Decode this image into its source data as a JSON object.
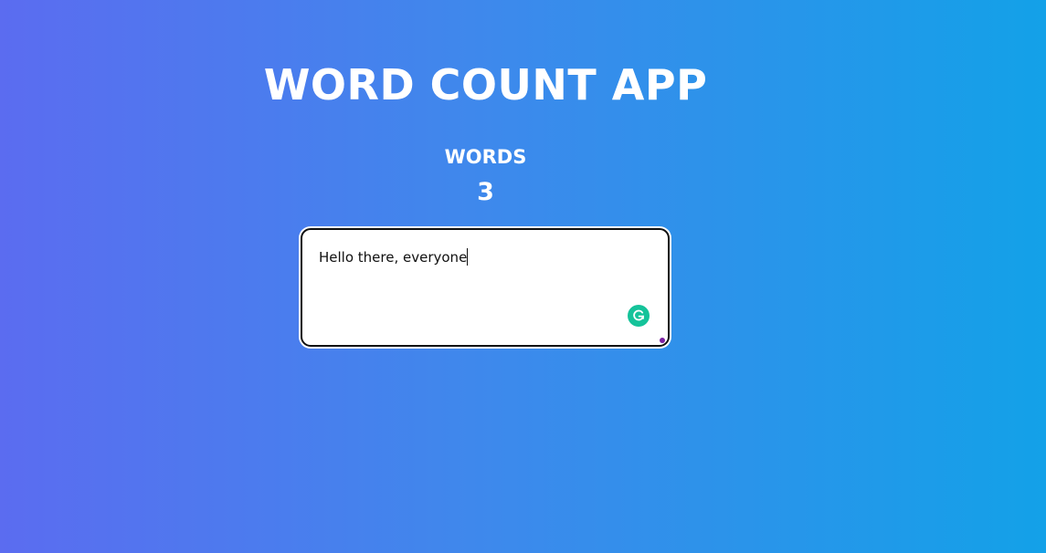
{
  "app": {
    "title": "WORD COUNT APP"
  },
  "counter": {
    "label": "WORDS",
    "value": "3"
  },
  "editor": {
    "text": "Hello there, everyone"
  },
  "icons": {
    "grammarly": "grammarly-icon",
    "resize": "resize-handle-icon"
  },
  "colors": {
    "gradient_start": "#5b6cf0",
    "gradient_end": "#13a1e8",
    "grammarly_green": "#15c39a"
  }
}
